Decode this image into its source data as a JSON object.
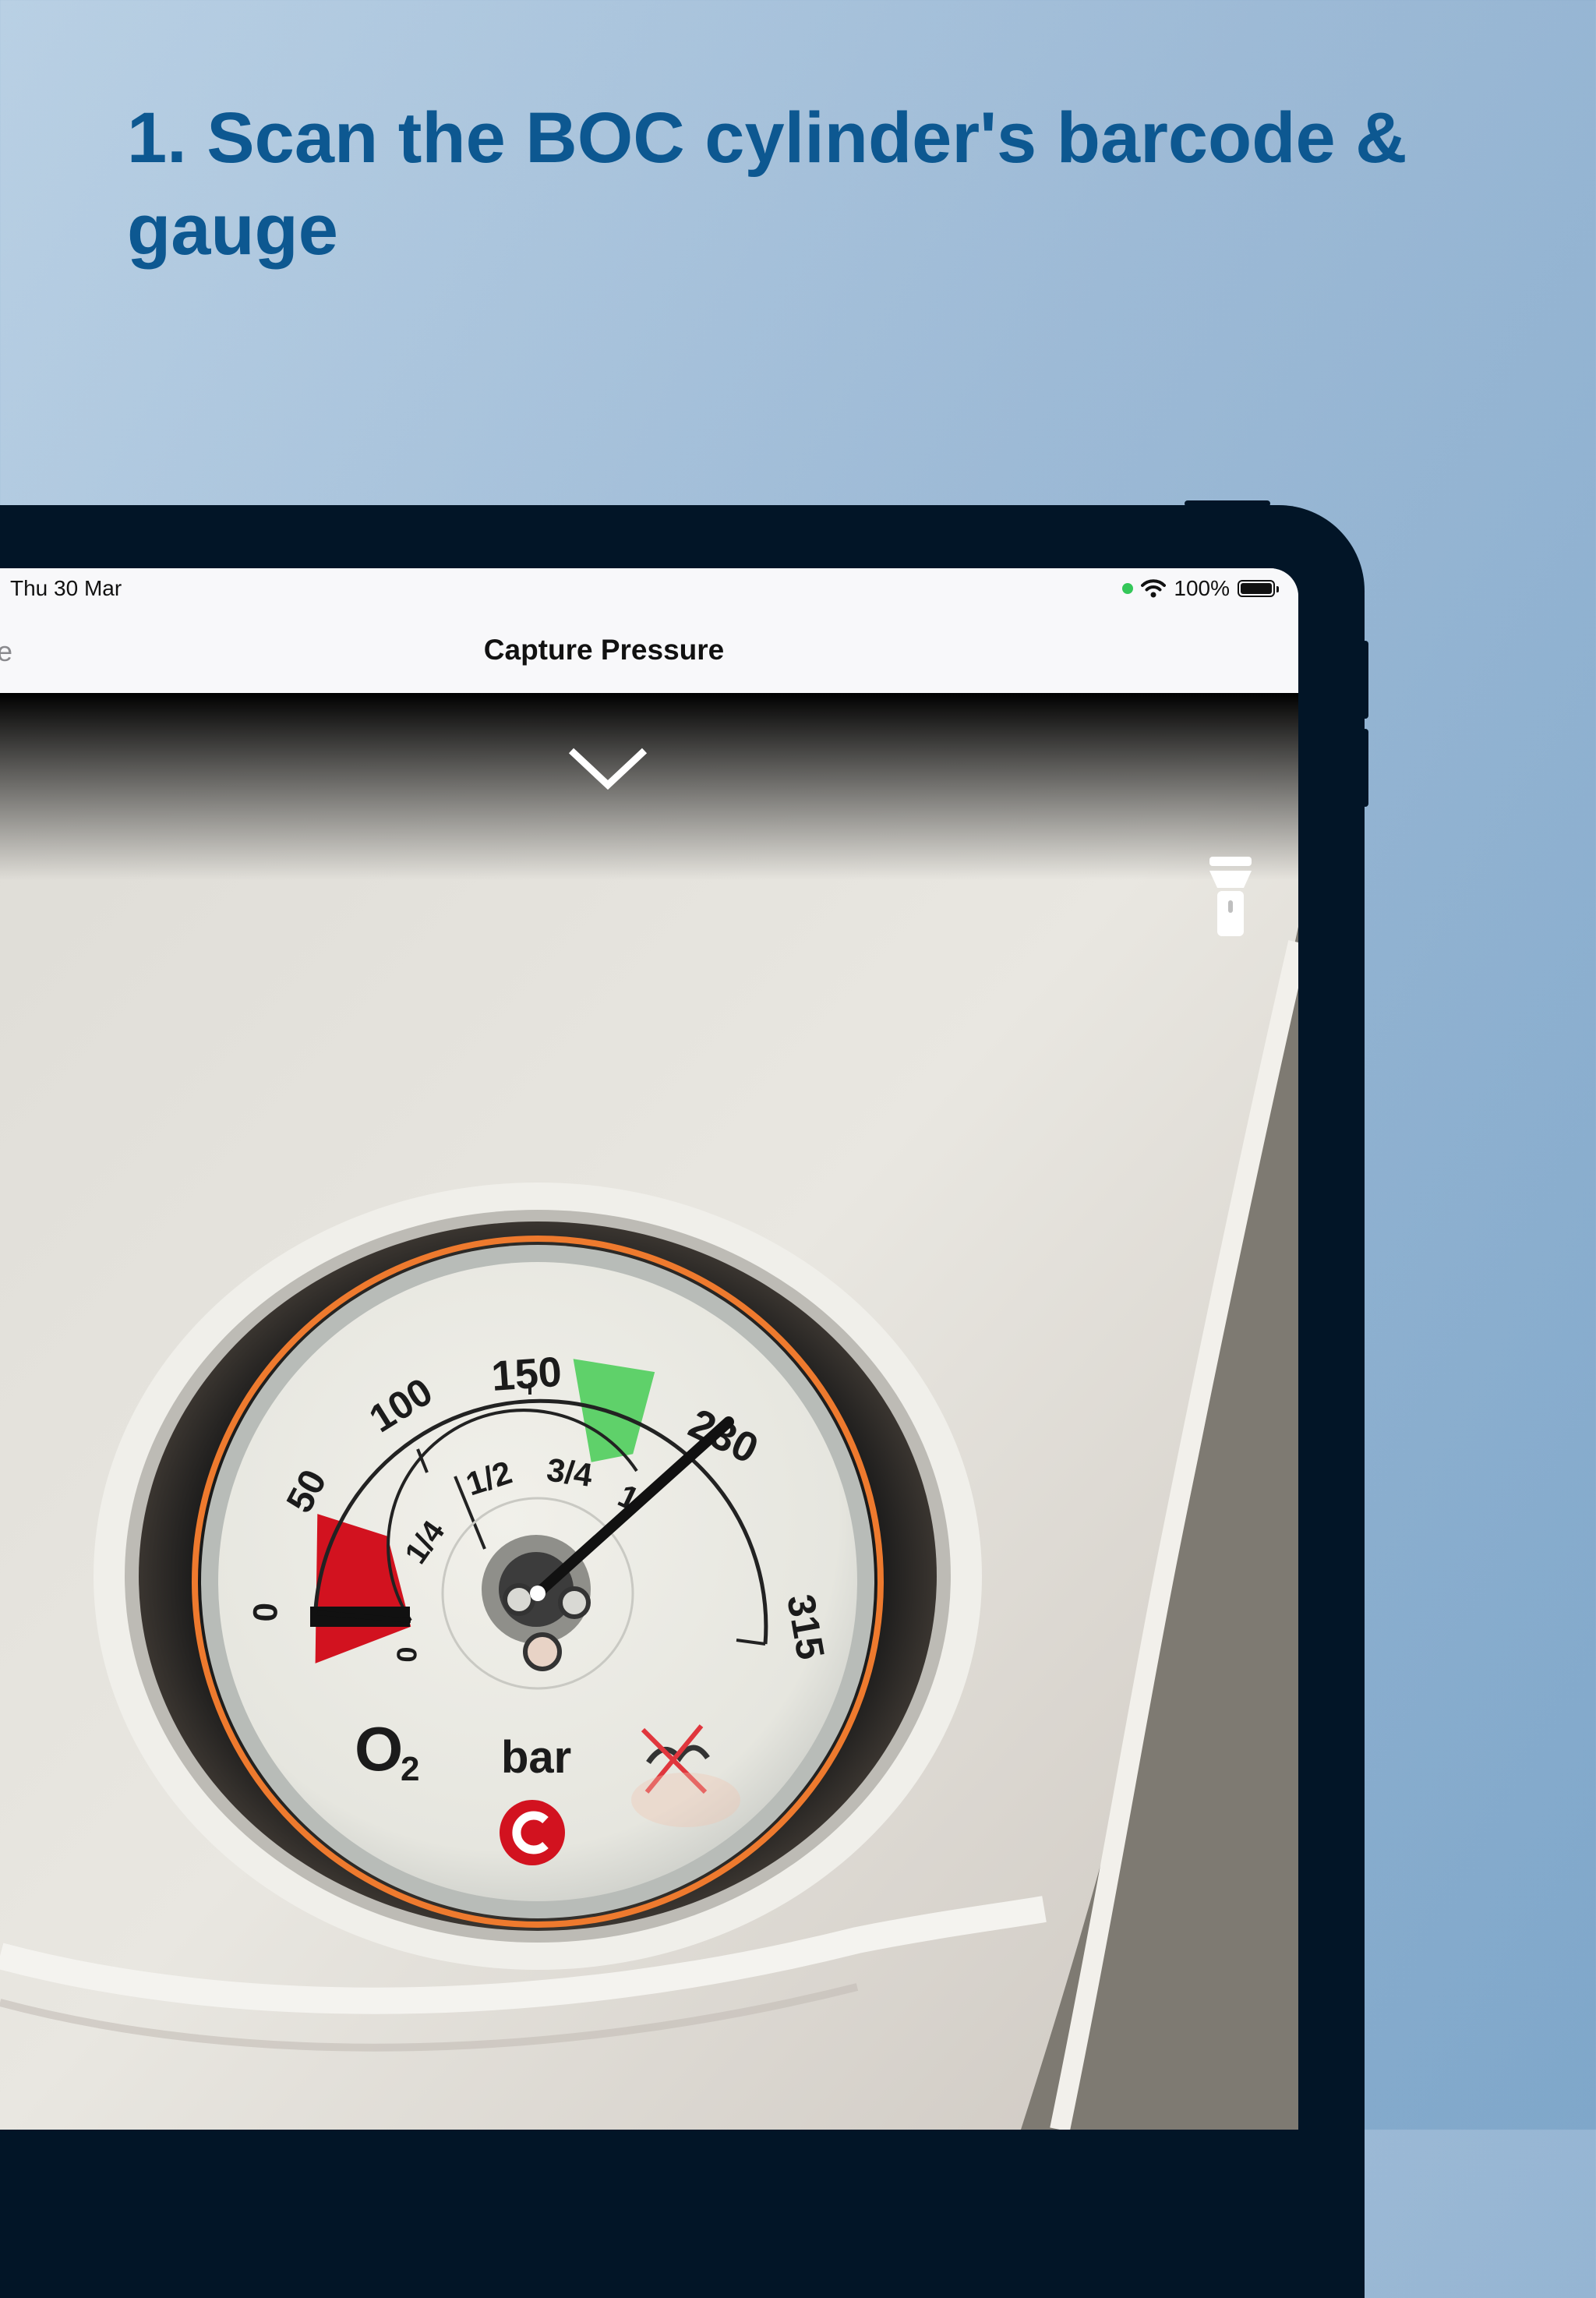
{
  "headline": "1. Scan the BOC cylinder's barcode & gauge",
  "status_bar": {
    "date": "Thu 30 Mar",
    "battery": "100%"
  },
  "nav": {
    "back_label": "e",
    "title": "Capture Pressure"
  },
  "icons": {
    "dismiss": "chevron-down-icon",
    "torch": "flashlight-icon",
    "wifi": "wifi-icon",
    "battery": "battery-icon"
  },
  "gauge": {
    "scale_labels": [
      "0",
      "50",
      "100",
      "150",
      "230",
      "315"
    ],
    "fraction_labels": [
      "0",
      "1/4",
      "1/2",
      "3/4",
      "1"
    ],
    "gas": "O",
    "gas_subscript": "2",
    "unit": "bar",
    "pressure_bar": 230,
    "scale_max_bar": 315
  },
  "colors": {
    "headline": "#0d5891",
    "device_frame": "#021527",
    "gauge_red_zone": "#d2121f",
    "gauge_green_zone": "#5fd16a",
    "gauge_rim": "#ee7a2e"
  }
}
